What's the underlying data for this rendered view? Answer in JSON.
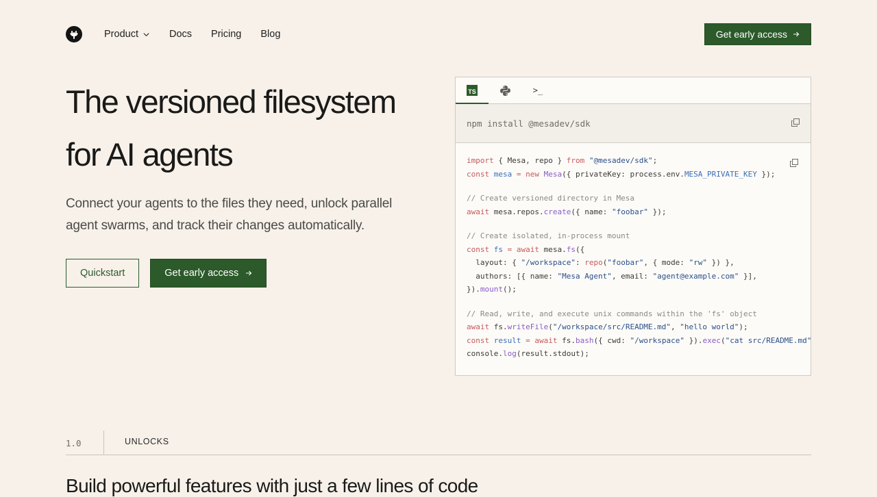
{
  "nav": {
    "logo_icon": "mesa-logo-icon",
    "items": [
      {
        "label": "Product",
        "has_dropdown": true
      },
      {
        "label": "Docs"
      },
      {
        "label": "Pricing"
      },
      {
        "label": "Blog"
      }
    ],
    "cta_label": "Get early access"
  },
  "hero": {
    "title_line1": "The versioned filesystem",
    "title_line2": "for AI agents",
    "subtitle": "Connect your agents to the files they need, unlock parallel agent swarms, and track their changes automatically.",
    "quickstart_label": "Quickstart",
    "cta_label": "Get early access"
  },
  "code_panel": {
    "tabs": [
      {
        "icon": "typescript-icon",
        "label": "TS",
        "active": true
      },
      {
        "icon": "python-icon",
        "active": false
      },
      {
        "icon": "terminal-icon",
        "label": ">_",
        "active": false
      }
    ],
    "install_command": "npm install @mesadev/sdk",
    "code": {
      "l1_import": "import",
      "l1_braces": " { Mesa, repo } ",
      "l1_from": "from",
      "l1_mod": "\"@mesadev/sdk\"",
      "l1_end": ";",
      "l2_const": "const",
      "l2_var": "mesa",
      "l2_eq": " = ",
      "l2_new": "new",
      "l2_class": "Mesa",
      "l2_args": "({ privateKey: process.env.",
      "l2_env": "MESA_PRIVATE_KEY",
      "l2_end": " });",
      "c1": "// Create versioned directory in Mesa",
      "l3_await": "await",
      "l3_obj": " mesa.repos.",
      "l3_fn": "create",
      "l3_args": "({ name: ",
      "l3_str": "\"foobar\"",
      "l3_end": " });",
      "c2": "// Create isolated, in-process mount",
      "l4_const": "const",
      "l4_var": "fs",
      "l4_eq": " = ",
      "l4_await": "await",
      "l4_obj": " mesa.",
      "l4_fn": "fs",
      "l4_end": "({",
      "l5_a": "  layout: { ",
      "l5_s1": "\"/workspace\"",
      "l5_b": ": ",
      "l5_fn": "repo",
      "l5_c": "(",
      "l5_s2": "\"foobar\"",
      "l5_d": ", { mode: ",
      "l5_s3": "\"rw\"",
      "l5_e": " }) },",
      "l6_a": "  authors: [{ name: ",
      "l6_s1": "\"Mesa Agent\"",
      "l6_b": ", email: ",
      "l6_s2": "\"agent@example.com\"",
      "l6_c": " }],",
      "l7_a": "}).",
      "l7_fn": "mount",
      "l7_b": "();",
      "c3": "// Read, write, and execute unix commands within the 'fs' object",
      "l8_await": "await",
      "l8_obj": " fs.",
      "l8_fn": "writeFile",
      "l8_a": "(",
      "l8_s1": "\"/workspace/src/README.md\"",
      "l8_b": ", ",
      "l8_s2": "\"hello world\"",
      "l8_c": ");",
      "l9_const": "const",
      "l9_var": "result",
      "l9_eq": " = ",
      "l9_await": "await",
      "l9_obj": " fs.",
      "l9_fn": "bash",
      "l9_a": "({ cwd: ",
      "l9_s1": "\"/workspace\"",
      "l9_b": " }).",
      "l9_fn2": "exec",
      "l9_c": "(",
      "l9_s2": "\"cat src/README.md\"",
      "l10_a": "console.",
      "l10_fn": "log",
      "l10_b": "(result.stdout);"
    }
  },
  "section": {
    "number": "1.0",
    "label": "UNLOCKS",
    "heading": "Build powerful features with just a few lines of code"
  },
  "colors": {
    "background": "#f7f1ea",
    "accent": "#2c5a2a",
    "keyword": "#c75a5a",
    "string": "#2b4f8a",
    "function": "#8a5cc7",
    "comment": "#8d8a83"
  }
}
